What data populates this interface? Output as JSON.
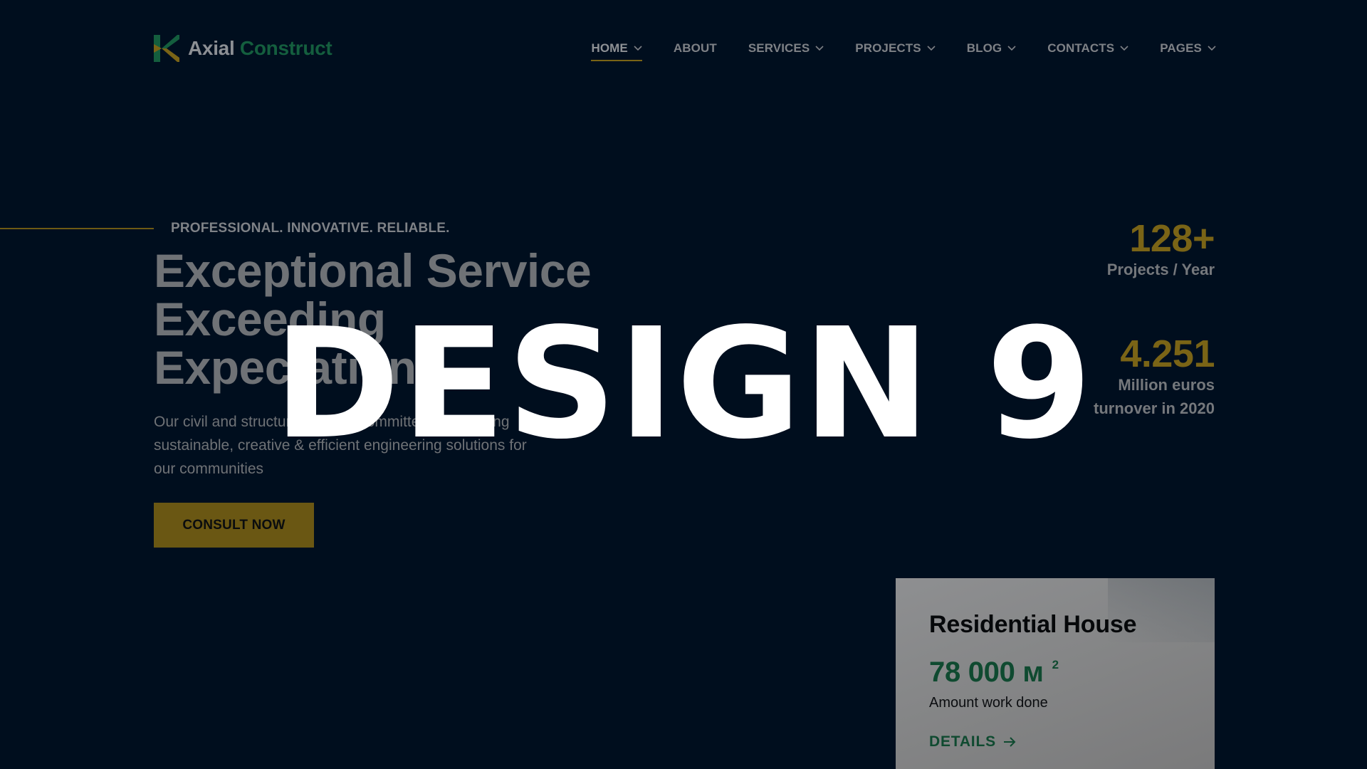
{
  "brand": {
    "name_part1": "Axial",
    "name_part2": "Construct"
  },
  "colors": {
    "background": "#000e1e",
    "accent_gold": "#7a6416",
    "brand_green": "#145e3e",
    "overlay_text": "#ffffff"
  },
  "nav": {
    "items": [
      {
        "label": "HOME",
        "has_dropdown": true,
        "active": true
      },
      {
        "label": "ABOUT",
        "has_dropdown": false
      },
      {
        "label": "SERVICES",
        "has_dropdown": true
      },
      {
        "label": "PROJECTS",
        "has_dropdown": true
      },
      {
        "label": "BLOG",
        "has_dropdown": true
      },
      {
        "label": "CONTACTS",
        "has_dropdown": true
      },
      {
        "label": "PAGES",
        "has_dropdown": true
      }
    ]
  },
  "hero": {
    "eyebrow": "PROFESSIONAL. INNOVATIVE. RELIABLE.",
    "title_lines": [
      "Exceptional Service",
      "Exceeding",
      "Expectations"
    ],
    "description": "Our civil and structural team is committed to providing sustainable, creative & efficient engineering solutions for our communities",
    "cta_label": "CONSULT NOW"
  },
  "stats": [
    {
      "value": "128+",
      "label_lines": [
        "Projects / Year"
      ]
    },
    {
      "value": "4.251",
      "label_lines": [
        "Million euros",
        "turnover in 2020"
      ]
    }
  ],
  "project_card": {
    "title": "Residential House",
    "amount": "78 000 м",
    "amount_sup": "2",
    "caption": "Amount work done",
    "link_label": "DETAILS"
  },
  "overlay": {
    "title": "DESIGN 9"
  },
  "icons": {
    "logo": "logo-k-icon",
    "dropdown": "chevron-down-icon",
    "details": "arrow-right-icon"
  }
}
